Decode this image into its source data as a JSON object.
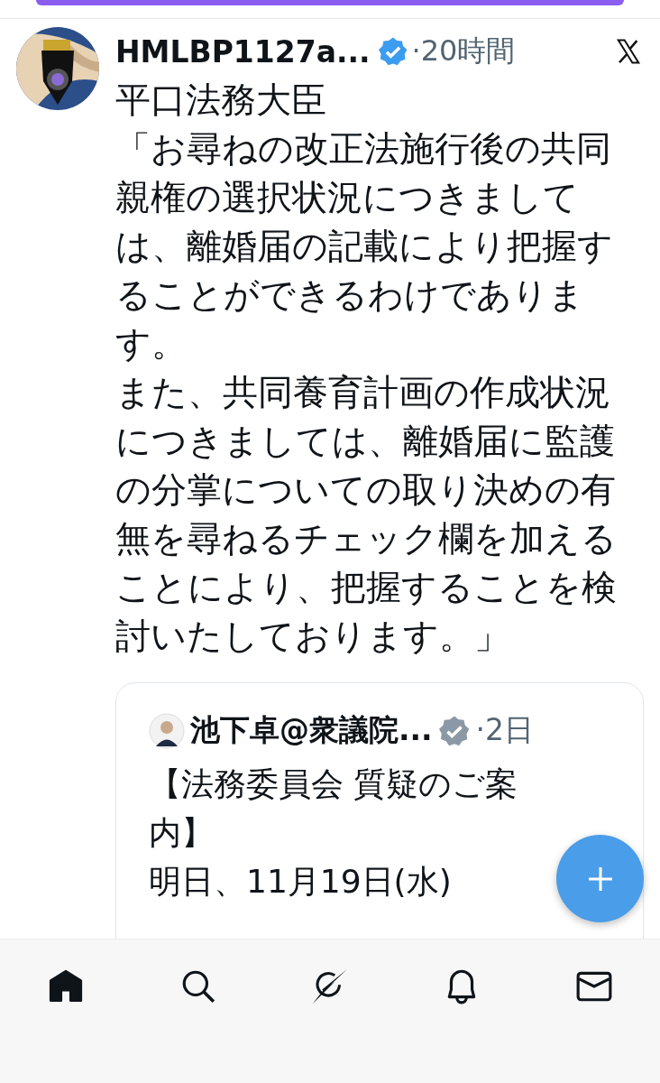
{
  "post": {
    "author": {
      "name": "HMLBP1127a...",
      "verified": true,
      "color": "#3b9cf0"
    },
    "time": "·20時間",
    "title": "平口法務大臣",
    "paragraphs": [
      "「お尋ねの改正法施行後の共同親権の選択状況につきましては、離婚届の記載により把握することができるわけであります。",
      "また、共同養育計画の作成状況につきましては、離婚届に監護の分掌についての取り決めの有無を尋ねるチェック欄を加えることにより、把握することを検討いたしております。」"
    ],
    "quote": {
      "author": {
        "name": "池下卓@衆議院...",
        "verified": true,
        "color": "#8b98a5"
      },
      "time": "·2日",
      "title": "【法務委員会 質疑のご案内】",
      "lines": [
        "明日、11月19日(水)"
      ]
    }
  },
  "nav": [
    {
      "kind": "home",
      "selected": true
    },
    {
      "kind": "search",
      "selected": false
    },
    {
      "kind": "grok",
      "selected": false
    },
    {
      "kind": "notifications",
      "selected": false
    },
    {
      "kind": "messages",
      "selected": false
    }
  ]
}
